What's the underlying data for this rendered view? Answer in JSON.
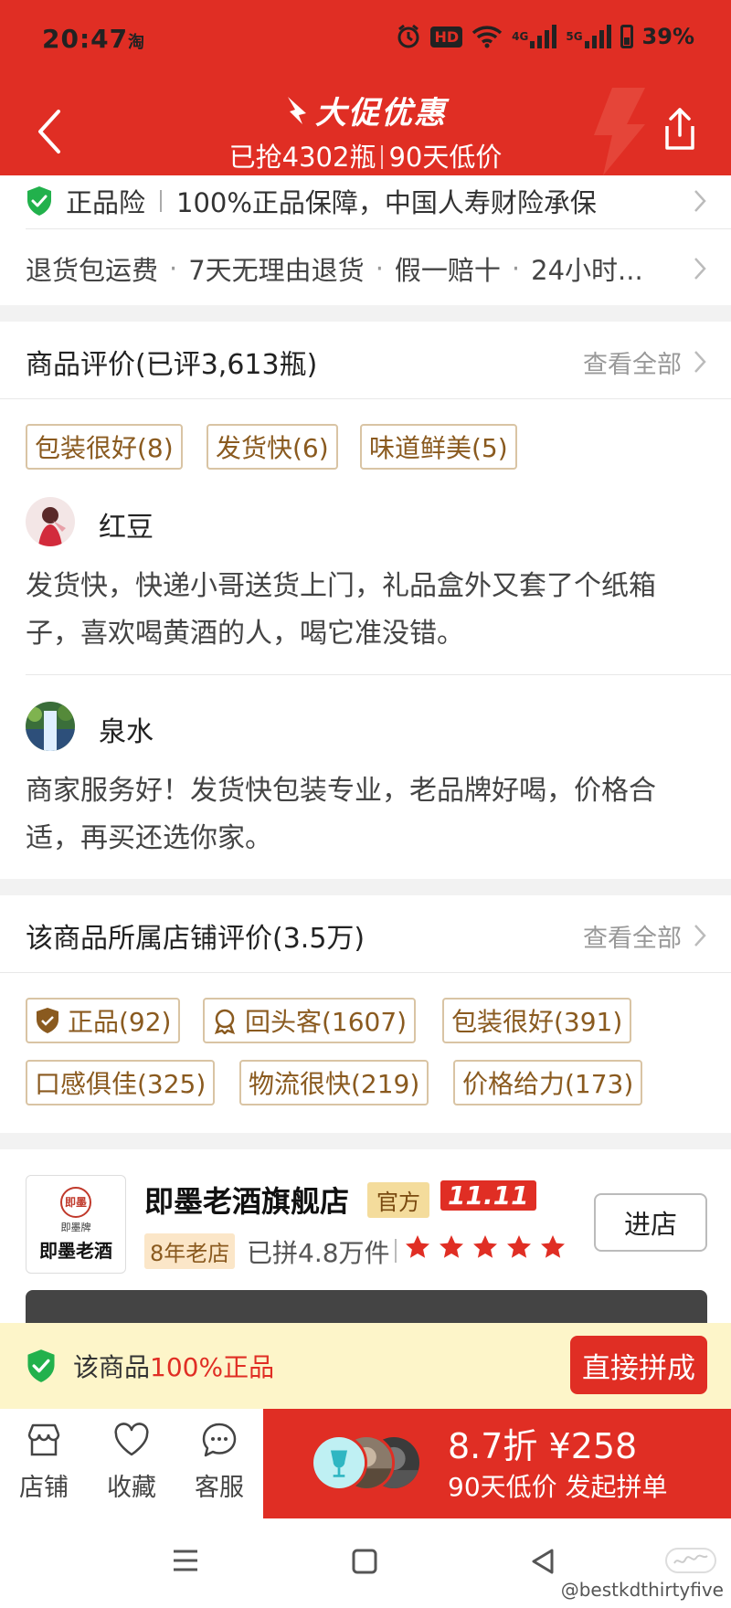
{
  "status_bar": {
    "time": "20:47",
    "app_indicator": "淘",
    "hd_label": "HD",
    "net1": "4G",
    "net2": "5G",
    "battery": "39%"
  },
  "header": {
    "title": "大促优惠",
    "subtitle_left": "已抢4302瓶",
    "subtitle_right": "90天低价",
    "icons": [
      "back-icon",
      "share-icon"
    ]
  },
  "guarantee": {
    "label": "正品险",
    "detail": "100%正品保障，中国人寿财险承保"
  },
  "services": [
    "退货包运费",
    "7天无理由退货",
    "假一赔十",
    "24小时..."
  ],
  "product_reviews": {
    "title": "商品评价(已评3,613瓶)",
    "view_all": "查看全部",
    "tags": [
      "包装很好(8)",
      "发货快(6)",
      "味道鲜美(5)"
    ],
    "items": [
      {
        "user": "红豆",
        "text": "发货快，快递小哥送货上门，礼品盒外又套了个纸箱子，喜欢喝黄酒的人，喝它准没错。"
      },
      {
        "user": "泉水",
        "text": "商家服务好！发货快包装专业，老品牌好喝，价格合适，再买还选你家。"
      }
    ]
  },
  "store_reviews": {
    "title": "该商品所属店铺评价(3.5万)",
    "view_all": "查看全部",
    "tags": [
      "正品(92)",
      "回头客(1607)",
      "包装很好(391)",
      "口感俱佳(325)",
      "物流很快(219)",
      "价格给力(173)"
    ]
  },
  "store": {
    "logo_seal": "即墨",
    "logo_small": "即墨牌",
    "logo_big": "即墨老酒",
    "name": "即墨老酒旗舰店",
    "badge_official": "官方",
    "badge_event": "11.11",
    "years": "8年老店",
    "sold": "已拼4.8万件",
    "rating_stars": 5,
    "enter_label": "进店"
  },
  "authenticity": {
    "text_prefix": "该商品",
    "text_highlight": "100%正品",
    "button": "直接拼成"
  },
  "action_bar": {
    "items": [
      {
        "label": "店铺",
        "icon": "store-icon"
      },
      {
        "label": "收藏",
        "icon": "heart-icon"
      },
      {
        "label": "客服",
        "icon": "chat-icon"
      }
    ],
    "price_line": "8.7折 ¥258",
    "sub_line": "90天低价 发起拼单"
  },
  "watermark": "@bestkdthirtyfive",
  "colors": {
    "brand_red": "#e02e24",
    "tag_border": "#d9c4a4",
    "tag_text": "#8a5a1f",
    "shield_green": "#22b14c",
    "auth_bg": "#fdf5c9"
  }
}
